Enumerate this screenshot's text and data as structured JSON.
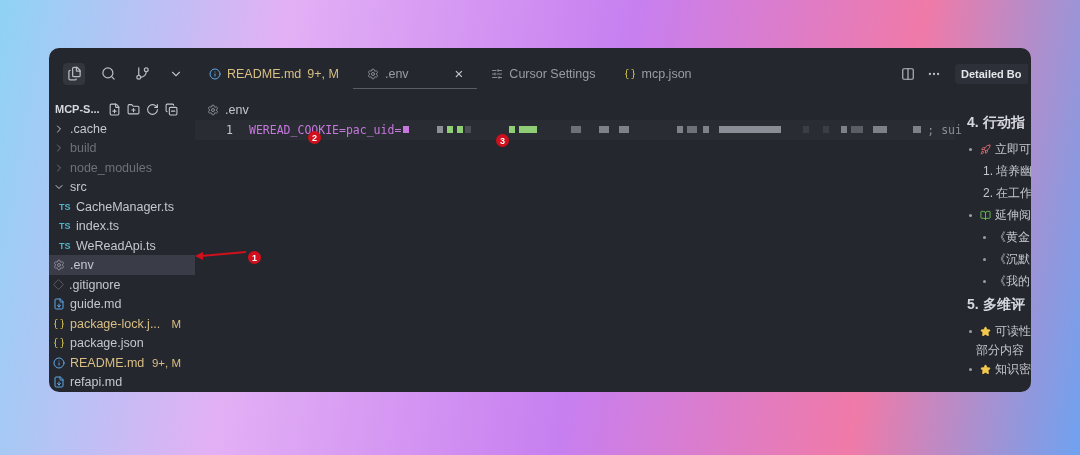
{
  "explorer": {
    "title": "MCP-S...",
    "items": [
      {
        "name": ".cache",
        "kind": "folder",
        "dimmed": false,
        "modified": false,
        "expanded": false,
        "selected": false
      },
      {
        "name": "build",
        "kind": "folder",
        "dimmed": true,
        "modified": false,
        "expanded": false,
        "selected": false
      },
      {
        "name": "node_modules",
        "kind": "folder",
        "dimmed": true,
        "modified": false,
        "expanded": false,
        "selected": false
      },
      {
        "name": "src",
        "kind": "folder",
        "dimmed": false,
        "modified": false,
        "expanded": true,
        "selected": false,
        "children": [
          {
            "name": "CacheManager.ts",
            "kind": "ts",
            "tag": "TS",
            "dimmed": false,
            "modified": false,
            "selected": false
          },
          {
            "name": "index.ts",
            "kind": "ts",
            "tag": "TS",
            "dimmed": false,
            "modified": false,
            "selected": false
          },
          {
            "name": "WeReadApi.ts",
            "kind": "ts",
            "tag": "TS",
            "dimmed": false,
            "modified": false,
            "selected": false
          }
        ]
      },
      {
        "name": ".env",
        "kind": "gear",
        "dimmed": false,
        "modified": false,
        "selected": true
      },
      {
        "name": ".gitignore",
        "kind": "git",
        "dimmed": false,
        "modified": false,
        "selected": false
      },
      {
        "name": "guide.md",
        "kind": "md",
        "dimmed": false,
        "modified": false,
        "selected": false
      },
      {
        "name": "package-lock.j...",
        "kind": "json",
        "dimmed": false,
        "modified": true,
        "badge": "M",
        "selected": false
      },
      {
        "name": "package.json",
        "kind": "json",
        "dimmed": false,
        "modified": false,
        "selected": false
      },
      {
        "name": "README.md",
        "kind": "info",
        "dimmed": false,
        "modified": true,
        "badge": "9+, M",
        "selected": false
      },
      {
        "name": "refapi.md",
        "kind": "md",
        "dimmed": false,
        "modified": false,
        "selected": false
      }
    ]
  },
  "tabs": [
    {
      "label": "README.md",
      "kind": "info",
      "badge": "9+, M",
      "selected": false
    },
    {
      "label": ".env",
      "kind": "gear",
      "close": "×",
      "selected": true
    },
    {
      "label": "Cursor Settings",
      "kind": "settings",
      "selected": false
    },
    {
      "label": "mcp.json",
      "kind": "json",
      "selected": false
    }
  ],
  "breadcrumb": ".env",
  "editor": {
    "lines": [
      {
        "number": "1",
        "before": "WEREAD_COOKIE=pac_uid=",
        "after": "; sui"
      }
    ]
  },
  "annotations": [
    "1",
    "2",
    "3"
  ],
  "right_panel": {
    "tab": "Detailed Bo",
    "blocks": [
      {
        "kind": "heading",
        "text": "4. 行动指"
      },
      {
        "kind": "rocket",
        "text": "立即可"
      },
      {
        "kind": "numbered",
        "text": "1. 培养幽"
      },
      {
        "kind": "numbered",
        "text": "2. 在工作"
      },
      {
        "kind": "books",
        "text": "延伸阅"
      },
      {
        "kind": "sub",
        "text": "《黄金"
      },
      {
        "kind": "sub",
        "text": "《沉默"
      },
      {
        "kind": "sub",
        "text": "《我的"
      },
      {
        "kind": "heading",
        "text": "5. 多维评"
      },
      {
        "kind": "star",
        "text": "可读性",
        "more": "部分内容"
      },
      {
        "kind": "star",
        "text": "知识密"
      }
    ]
  }
}
